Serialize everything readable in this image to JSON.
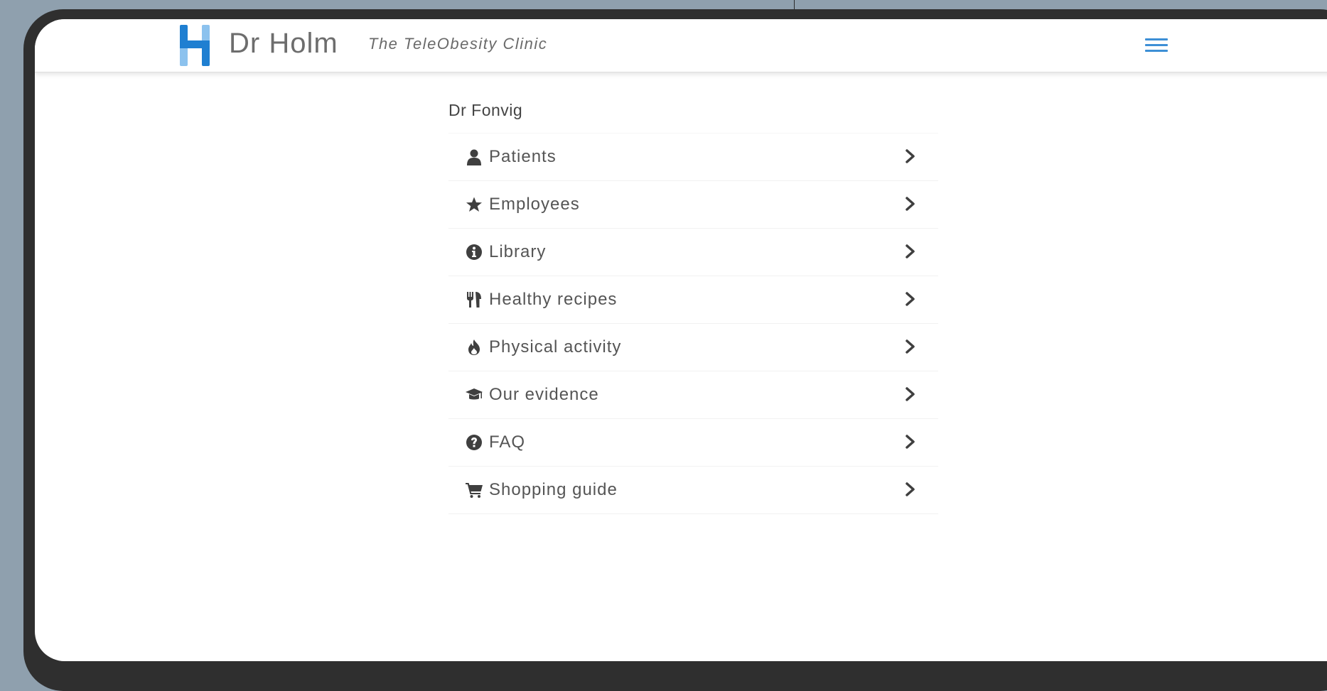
{
  "header": {
    "brand": "Dr Holm",
    "tagline": "The TeleObesity Clinic"
  },
  "user": {
    "name": "Dr Fonvig"
  },
  "menu": {
    "items": [
      {
        "label": "Patients",
        "icon": "user-icon"
      },
      {
        "label": "Employees",
        "icon": "star-icon"
      },
      {
        "label": "Library",
        "icon": "info-icon"
      },
      {
        "label": "Healthy recipes",
        "icon": "cutlery-icon"
      },
      {
        "label": "Physical activity",
        "icon": "flame-icon"
      },
      {
        "label": "Our evidence",
        "icon": "graduation-cap-icon"
      },
      {
        "label": "FAQ",
        "icon": "question-icon"
      },
      {
        "label": "Shopping guide",
        "icon": "cart-icon"
      }
    ]
  },
  "colors": {
    "accent": "#3d8fd6",
    "logo_dark": "#1f7fd1",
    "logo_light": "#8cc2ee",
    "frame": "#2f2f2f",
    "background": "#8fa0ae"
  }
}
